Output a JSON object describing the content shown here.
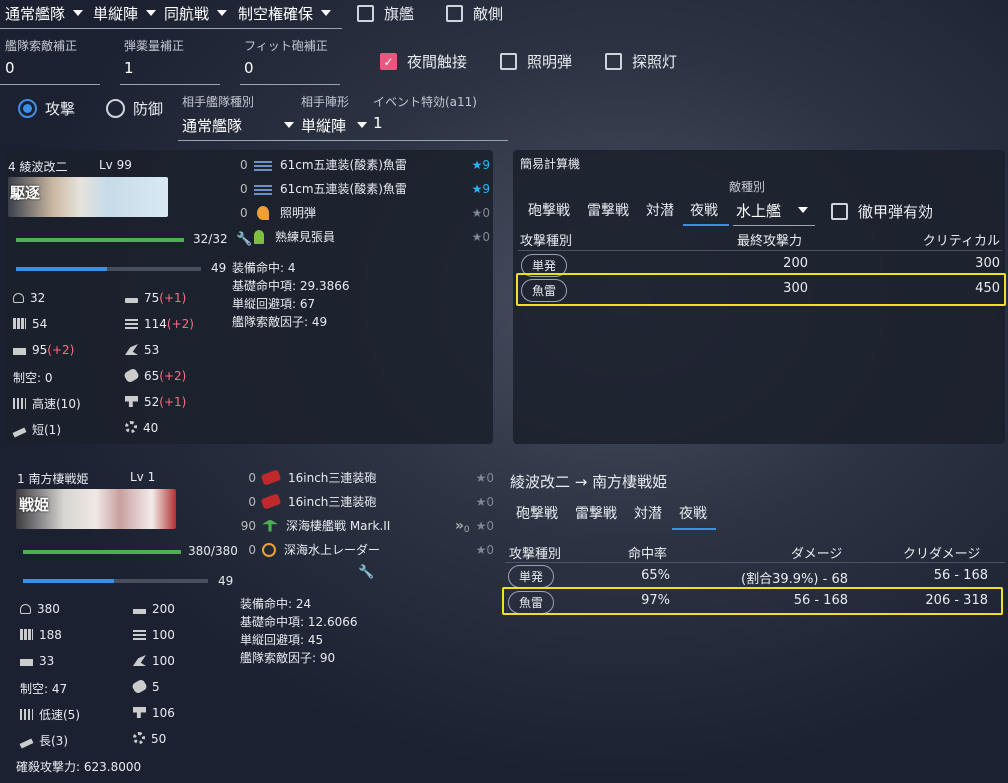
{
  "top": {
    "fleet_type": "通常艦隊",
    "formation": "単縦陣",
    "engagement": "同航戦",
    "air_state": "制空権確保",
    "flagship_label": "旗艦",
    "enemy_side_label": "敵側",
    "recon_label": "艦隊索敵補正",
    "recon_value": "0",
    "ammo_label": "弾薬量補正",
    "ammo_value": "1",
    "fit_label": "フィット砲補正",
    "fit_value": "0",
    "night_contact_label": "夜間触接",
    "star_shell_label": "照明弾",
    "searchlight_label": "探照灯",
    "attack_label": "攻撃",
    "defense_label": "防御",
    "enemy_fleet_type_label": "相手艦隊種別",
    "enemy_fleet_type": "通常艦隊",
    "enemy_formation_label": "相手陣形",
    "enemy_formation": "単縦陣",
    "event_bonus_label": "イベント特効(a11)",
    "event_bonus": "1"
  },
  "ship1": {
    "name": "4 綾波改二",
    "level": "Lv 99",
    "badge": "駆逐",
    "hp": "32/32",
    "morale": "49",
    "equips": [
      {
        "slot": "0",
        "name": "61cm五連装(酸素)魚雷",
        "star": "★9"
      },
      {
        "slot": "0",
        "name": "61cm五連装(酸素)魚雷",
        "star": "★9"
      },
      {
        "slot": "0",
        "name": "照明弾",
        "star": "★0"
      },
      {
        "slot": "",
        "name": "熟練見張員",
        "star": "★0"
      }
    ],
    "stats": {
      "hp": "32",
      "firepower": "75",
      "firepower_bonus": "(+1)",
      "armor": "54",
      "torpedo": "114",
      "torpedo_bonus": "(+2)",
      "evasion": "95",
      "evasion_bonus": "(+2)",
      "aa": "53",
      "air": "制空: 0",
      "asw": "65",
      "asw_bonus": "(+2)",
      "speed": "高速(10)",
      "los": "52",
      "los_bonus": "(+1)",
      "range": "短(1)",
      "luck": "40"
    },
    "details": [
      "装備命中: 4",
      "基礎命中項: 29.3866",
      "単縦回避項: 67",
      "艦隊索敵因子: 49"
    ]
  },
  "calc": {
    "title": "簡易計算機",
    "tabs": [
      "砲撃戦",
      "雷撃戦",
      "対潜",
      "夜戦"
    ],
    "enemy_type_label": "敵種別",
    "enemy_type": "水上艦",
    "ap_label": "徹甲弾有効",
    "headers": [
      "攻撃種別",
      "最終攻撃力",
      "クリティカル"
    ],
    "rows": [
      {
        "type": "単発",
        "power": "200",
        "crit": "300"
      },
      {
        "type": "魚雷",
        "power": "300",
        "crit": "450"
      }
    ]
  },
  "ship2": {
    "name": "1 南方棲戦姫",
    "level": "Lv 1",
    "badge": "戦姫",
    "hp": "380/380",
    "morale": "49",
    "equips": [
      {
        "slot": "0",
        "name": "16inch三連装砲",
        "star": "★0"
      },
      {
        "slot": "0",
        "name": "16inch三連装砲",
        "star": "★0"
      },
      {
        "slot": "90",
        "name": "深海棲艦戦 Mark.II",
        "star": "★0",
        "prof": "0"
      },
      {
        "slot": "0",
        "name": "深海水上レーダー",
        "star": "★0"
      }
    ],
    "stats": {
      "hp": "380",
      "firepower": "200",
      "armor": "188",
      "torpedo": "100",
      "evasion": "33",
      "aa": "100",
      "air": "制空: 47",
      "asw": "5",
      "speed": "低速(5)",
      "los": "106",
      "range": "長(3)",
      "luck": "50"
    },
    "details": [
      "装備命中: 24",
      "基礎命中項: 12.6066",
      "単縦回避項: 45",
      "艦隊索敵因子: 90"
    ],
    "kill_power": "確殺攻撃力: 623.8000"
  },
  "result": {
    "title": "綾波改二 → 南方棲戦姫",
    "tabs": [
      "砲撃戦",
      "雷撃戦",
      "対潜",
      "夜戦"
    ],
    "headers": [
      "攻撃種別",
      "命中率",
      "ダメージ",
      "クリダメージ"
    ],
    "rows": [
      {
        "type": "単発",
        "hit": "65%",
        "damage": "(割合39.9%) - 68",
        "crit": "56 - 168"
      },
      {
        "type": "魚雷",
        "hit": "97%",
        "damage": "56 - 168",
        "crit": "206 - 318"
      }
    ]
  },
  "colors": {
    "accent": "#3d8fe6",
    "checked": "#e8577e",
    "hp_bar": "#4caf50",
    "morale_bar": "#3d8fe6",
    "highlight": "#f0e020",
    "bonus": "#ff6c7e",
    "star": "#29b6f6"
  }
}
